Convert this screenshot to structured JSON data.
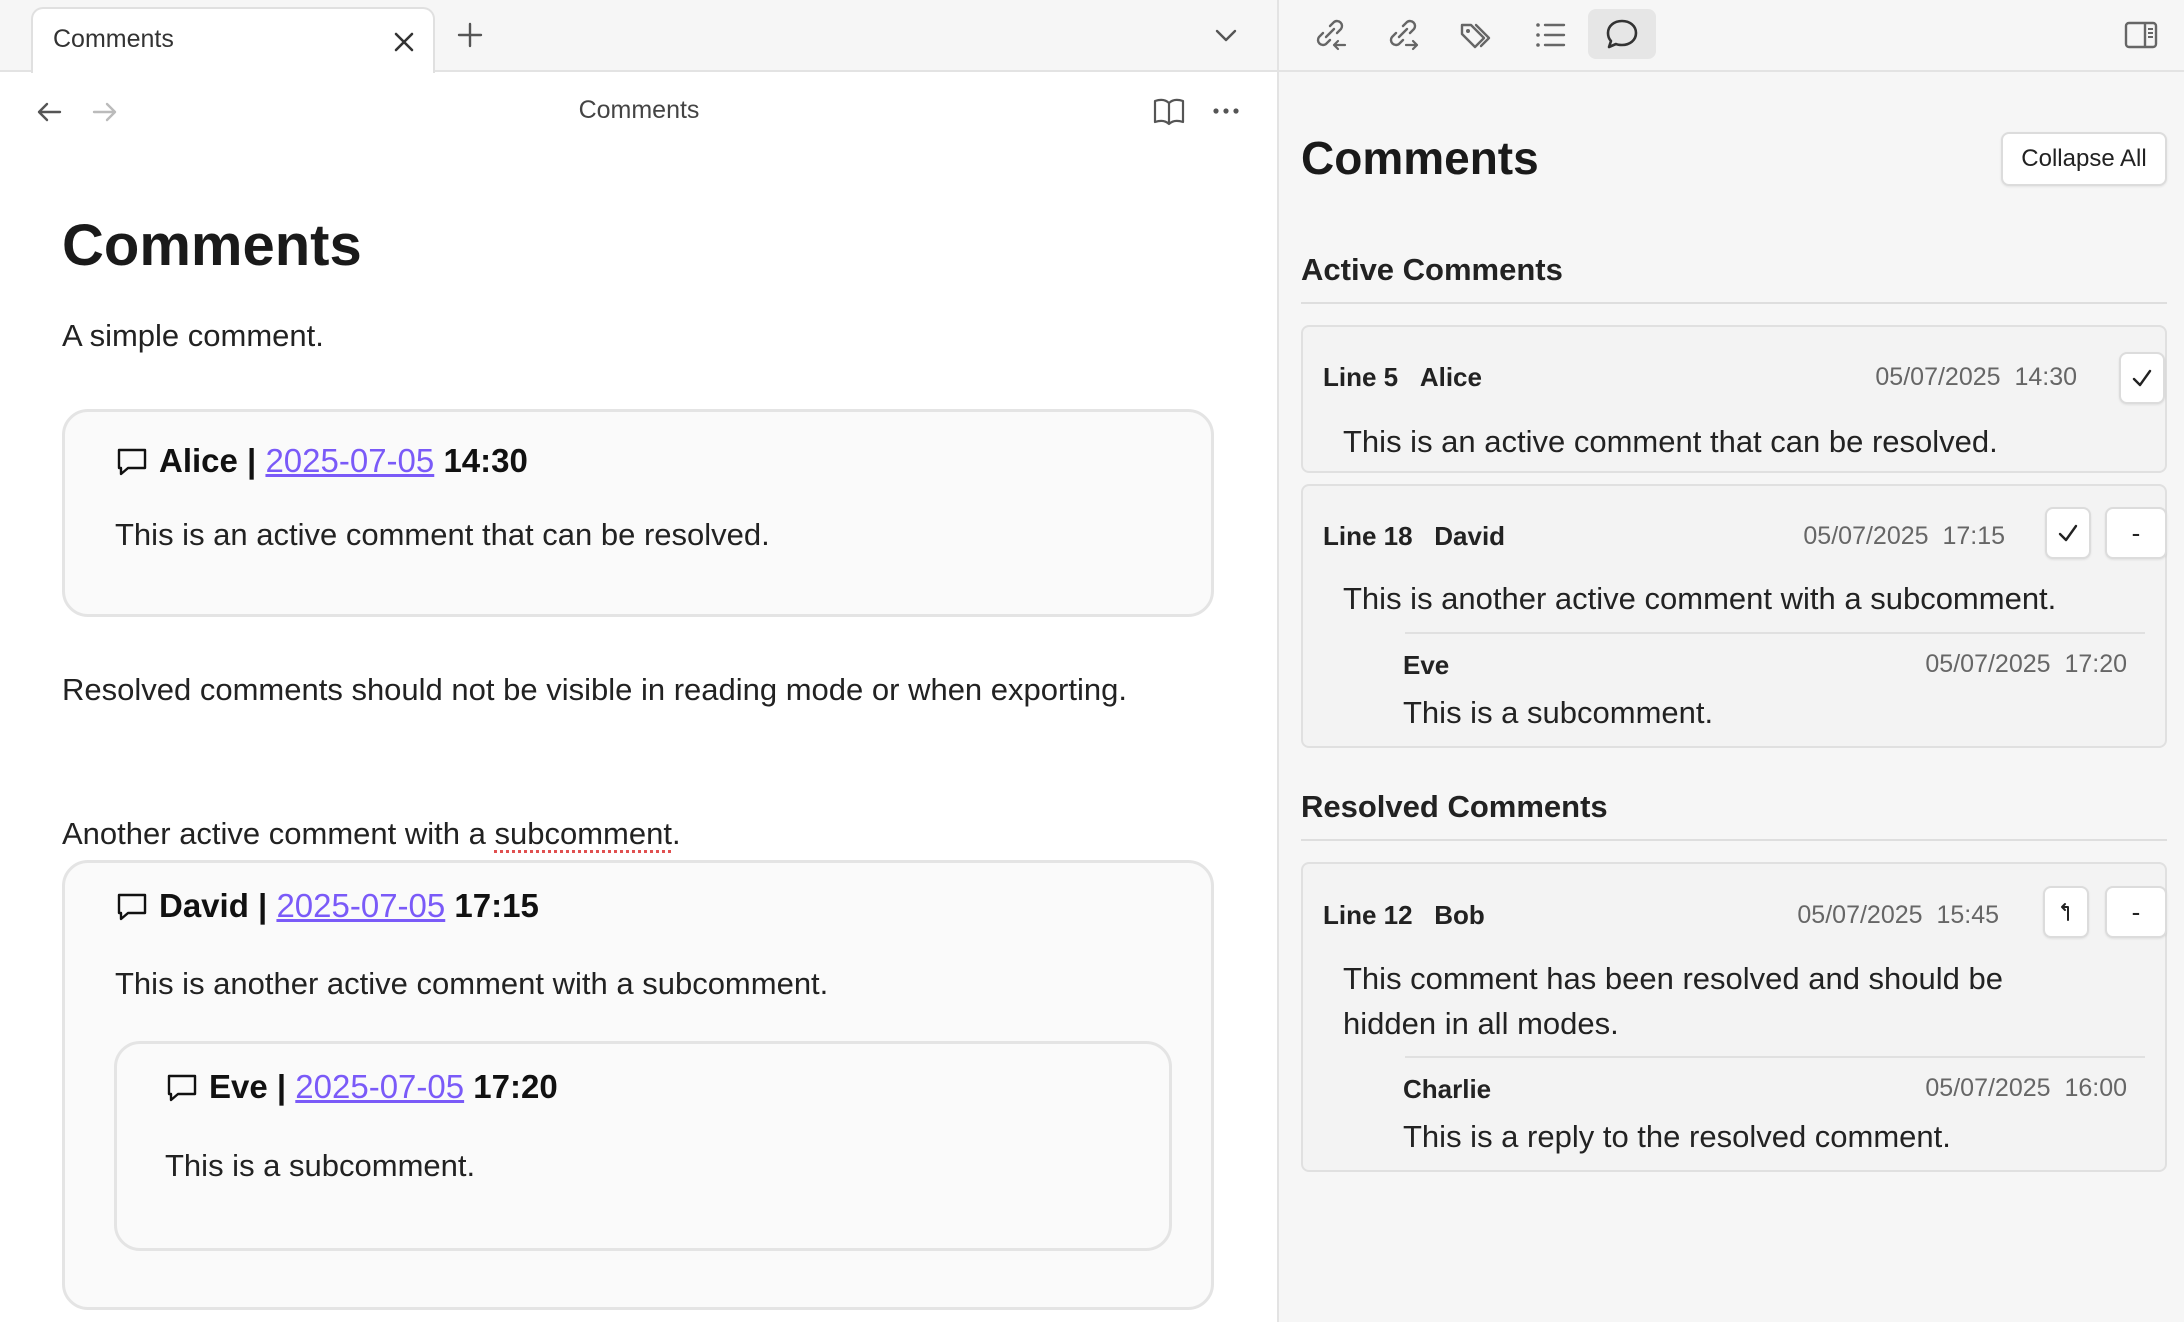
{
  "tab": {
    "title": "Comments"
  },
  "view_header": {
    "title": "Comments"
  },
  "note": {
    "title": "Comments",
    "paragraph1": "A simple comment.",
    "callout1": {
      "author": "Alice |",
      "date": "2025-07-05",
      "time": "14:30",
      "text": "This is an active comment that can be resolved."
    },
    "paragraph2": "Resolved comments should not be visible in reading mode or when exporting.",
    "paragraph3_before": "Another active comment with a ",
    "paragraph3_misspelled": "subcomment",
    "paragraph3_after": ".",
    "callout2": {
      "author": "David |",
      "date": "2025-07-05",
      "time": "17:15",
      "text": "This is another active comment with a subcomment.",
      "nested": {
        "author": "Eve |",
        "date": "2025-07-05",
        "time": "17:20",
        "text": "This is a subcomment."
      }
    }
  },
  "panel": {
    "title": "Comments",
    "collapse_label": "Collapse All",
    "active_heading": "Active Comments",
    "resolved_heading": "Resolved Comments",
    "active": [
      {
        "line": "Line 5",
        "author": "Alice",
        "date": "05/07/2025",
        "time": "14:30",
        "text": "This is an active comment that can be resolved."
      },
      {
        "line": "Line 18",
        "author": "David",
        "date": "05/07/2025",
        "time": "17:15",
        "text": "This is another active comment with a subcomment.",
        "delete_label": "-",
        "reply": {
          "author": "Eve",
          "date": "05/07/2025",
          "time": "17:20",
          "text": "This is a subcomment."
        }
      }
    ],
    "resolved": [
      {
        "line": "Line 12",
        "author": "Bob",
        "date": "05/07/2025",
        "time": "15:45",
        "text": "This comment has been resolved and should be hidden in all modes.",
        "delete_label": "-",
        "reply": {
          "author": "Charlie",
          "date": "05/07/2025",
          "time": "16:00",
          "text": "This is a reply to the resolved comment."
        }
      }
    ]
  },
  "icons": {
    "toolbar": [
      "backlinks-icon",
      "outgoing-links-icon",
      "tags-icon",
      "outline-icon",
      "comments-icon"
    ],
    "collapse_sidebar": "sidebar-toggle-icon"
  },
  "colors": {
    "link": "#7a5af8",
    "pane_bg": "#f6f6f6",
    "card_bg": "#f3f3f3",
    "spellcheck": "#e05050"
  }
}
